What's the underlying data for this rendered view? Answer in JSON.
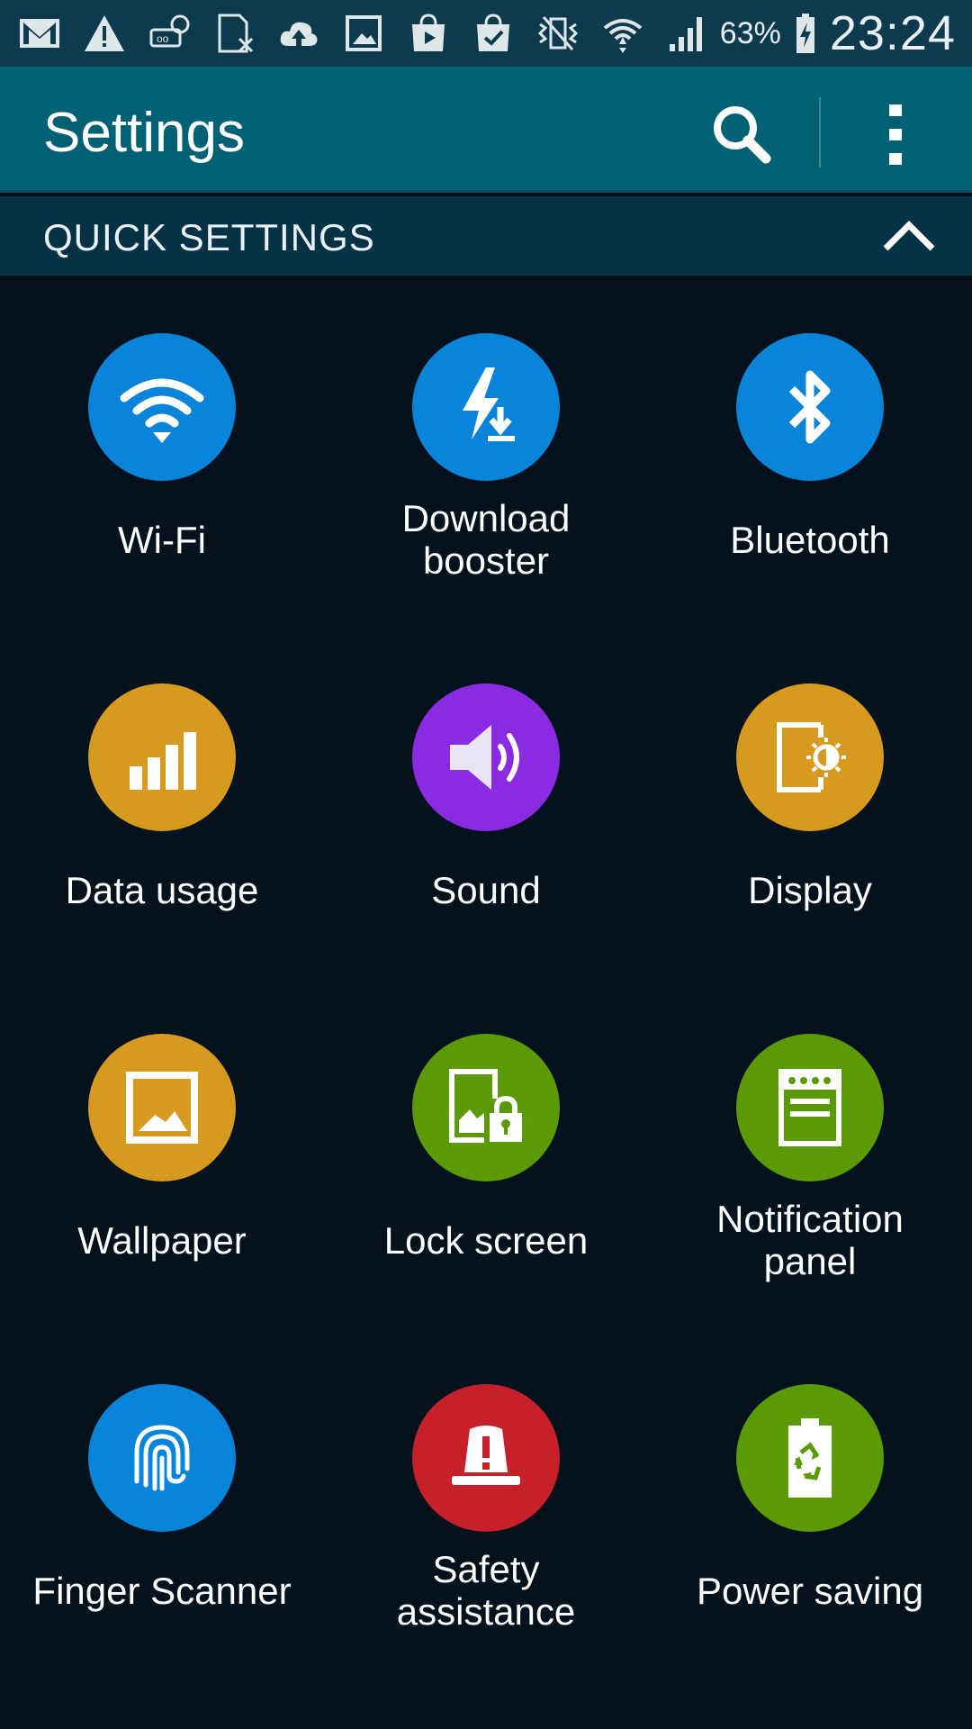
{
  "status_bar": {
    "icons": [
      "gmail-icon",
      "warning-icon",
      "voicemail-icon",
      "sim-missing-icon",
      "cloud-upload-icon",
      "image-icon",
      "play-store-icon",
      "shopping-bag-check-icon",
      "vibrate-icon",
      "wifi-icon",
      "signal-icon"
    ],
    "battery_percent": "63%",
    "time": "23:24"
  },
  "action_bar": {
    "title": "Settings",
    "search_icon": "search-icon",
    "more_icon": "more-vert-icon"
  },
  "section": {
    "title": "QUICK SETTINGS",
    "toggle_icon": "chevron-up-icon"
  },
  "tiles": [
    {
      "label": "Wi-Fi",
      "icon": "wifi-icon",
      "color": "#0a84d8"
    },
    {
      "label": "Download booster",
      "icon": "download-booster-icon",
      "color": "#0a84d8"
    },
    {
      "label": "Bluetooth",
      "icon": "bluetooth-icon",
      "color": "#0a84d8"
    },
    {
      "label": "Data usage",
      "icon": "data-usage-icon",
      "color": "#d79a1f"
    },
    {
      "label": "Sound",
      "icon": "speaker-icon",
      "color": "#8b2be1"
    },
    {
      "label": "Display",
      "icon": "display-icon",
      "color": "#d79a1f"
    },
    {
      "label": "Wallpaper",
      "icon": "wallpaper-icon",
      "color": "#d79a1f"
    },
    {
      "label": "Lock screen",
      "icon": "lock-screen-icon",
      "color": "#5a9a07"
    },
    {
      "label": "Notification panel",
      "icon": "notification-panel-icon",
      "color": "#5a9a07"
    },
    {
      "label": "Finger Scanner",
      "icon": "fingerprint-icon",
      "color": "#0a84d8"
    },
    {
      "label": "Safety assistance",
      "icon": "safety-alarm-icon",
      "color": "#c6202a"
    },
    {
      "label": "Power saving",
      "icon": "power-saving-icon",
      "color": "#5a9a07"
    }
  ]
}
